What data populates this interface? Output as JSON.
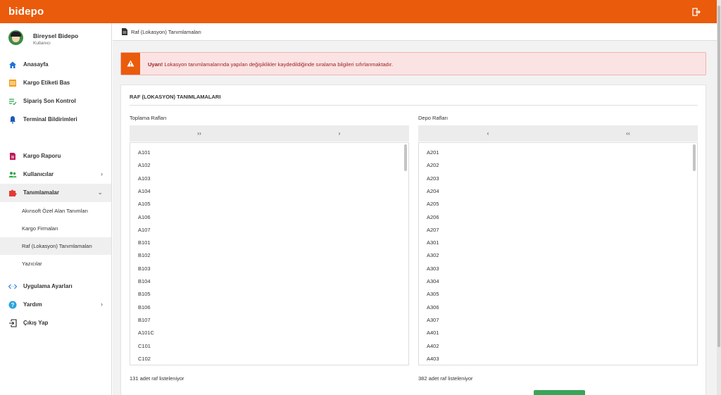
{
  "app": {
    "logo": "bidepo"
  },
  "topbar": {
    "logout_icon": "logout-icon"
  },
  "user": {
    "name": "Bireysel Bidepo",
    "role": "Kullanıcı"
  },
  "sidebar": {
    "items": [
      {
        "label": "Anasayfa",
        "icon": "home-icon"
      },
      {
        "label": "Kargo Etiketi Bas",
        "icon": "barcode-icon"
      },
      {
        "label": "Sipariş Son Kontrol",
        "icon": "checklist-icon"
      },
      {
        "label": "Terminal Bildirimleri",
        "icon": "bell-icon"
      },
      {
        "label": "Kargo Raporu",
        "icon": "report-icon"
      },
      {
        "label": "Kullanıcılar",
        "icon": "users-icon"
      },
      {
        "label": "Tanımlamalar",
        "icon": "puzzle-icon"
      },
      {
        "label": "Uygulama Ayarları",
        "icon": "code-icon"
      },
      {
        "label": "Yardım",
        "icon": "help-icon"
      },
      {
        "label": "Çıkış Yap",
        "icon": "exit-icon"
      }
    ],
    "subitems": [
      {
        "label": "Akınsoft Özel Alan Tanımları"
      },
      {
        "label": "Kargo Firmaları"
      },
      {
        "label": "Raf (Lokasyon) Tanımlamaları"
      },
      {
        "label": "Yazıcılar"
      }
    ]
  },
  "breadcrumb": {
    "title": "Raf (Lokasyon) Tanımlamaları"
  },
  "alert": {
    "strong": "Uyarı!",
    "message": " Lokasyon tanımlamalarında yapılan değişiklikler kaydedildiğinde sıralama bilgileri sıfırlanmaktadır."
  },
  "card": {
    "title": "RAF (LOKASYON) TANIMLAMALARI"
  },
  "left_list": {
    "title": "Toplama Rafları",
    "btn_all": "››",
    "btn_one": "›",
    "items": [
      "A101",
      "A102",
      "A103",
      "A104",
      "A105",
      "A106",
      "A107",
      "B101",
      "B102",
      "B103",
      "B104",
      "B105",
      "B106",
      "B107",
      "A101C",
      "C101",
      "C102"
    ],
    "count_text": "131 adet raf listeleniyor"
  },
  "right_list": {
    "title": "Depo Rafları",
    "btn_one": "‹",
    "btn_all": "‹‹",
    "items": [
      "A201",
      "A202",
      "A203",
      "A204",
      "A205",
      "A206",
      "A207",
      "A301",
      "A302",
      "A303",
      "A304",
      "A305",
      "A306",
      "A307",
      "A401",
      "A402",
      "A403"
    ],
    "count_text": "382 adet raf listeleniyor"
  },
  "colors": {
    "brand": "#ea5b0c",
    "alert_bg": "#fbe3e3",
    "alert_text": "#9b1c1c",
    "save": "#3aa55a"
  }
}
